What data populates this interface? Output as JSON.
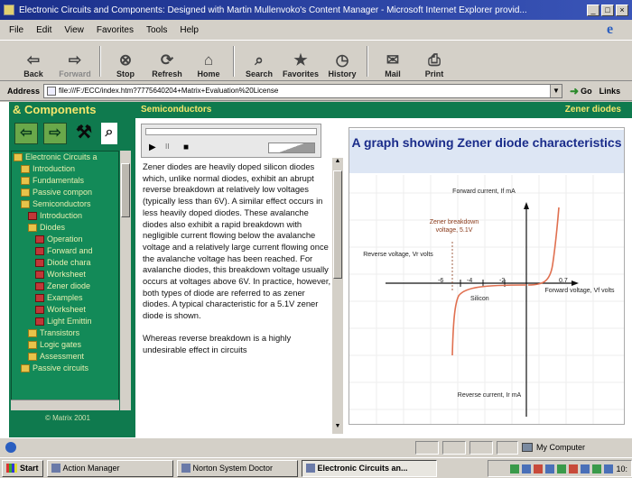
{
  "window": {
    "title": "Electronic Circuits and Components: Designed with Martin Mullenvoko's Content Manager - Microsoft Internet Explorer provid...",
    "controls": [
      "_",
      "□",
      "×"
    ]
  },
  "menu": [
    "File",
    "Edit",
    "View",
    "Favorites",
    "Tools",
    "Help"
  ],
  "toolbar": {
    "buttons": [
      {
        "label": "Back",
        "icon": "back-arrow-icon",
        "glyph": "⇦"
      },
      {
        "label": "Forward",
        "icon": "forward-arrow-icon",
        "glyph": "⇨"
      },
      {
        "label": "Stop",
        "icon": "stop-icon",
        "glyph": "⊗"
      },
      {
        "label": "Refresh",
        "icon": "refresh-icon",
        "glyph": "⟳"
      },
      {
        "label": "Home",
        "icon": "home-icon",
        "glyph": "⌂"
      },
      {
        "label": "Search",
        "icon": "search-icon",
        "glyph": "⌕"
      },
      {
        "label": "Favorites",
        "icon": "favorites-icon",
        "glyph": "★"
      },
      {
        "label": "History",
        "icon": "history-icon",
        "glyph": "◷"
      },
      {
        "label": "Mail",
        "icon": "mail-icon",
        "glyph": "✉"
      },
      {
        "label": "Print",
        "icon": "print-icon",
        "glyph": "⎙"
      }
    ]
  },
  "address": {
    "label": "Address",
    "url": "file:///F:/ECC/index.htm?7775640204+Matrix+Evaluation%20License",
    "go": "Go",
    "links": "Links"
  },
  "nav": {
    "header": "& Components",
    "tree": [
      {
        "label": "Electronic Circuits a",
        "type": "folder",
        "indent": 0
      },
      {
        "label": "Introduction",
        "type": "folder",
        "indent": 1
      },
      {
        "label": "Fundamentals",
        "type": "folder",
        "indent": 1
      },
      {
        "label": "Passive compon",
        "type": "folder",
        "indent": 1
      },
      {
        "label": "Semiconductors",
        "type": "folder",
        "indent": 1
      },
      {
        "label": "Introduction",
        "type": "diode",
        "indent": 2
      },
      {
        "label": "Diodes",
        "type": "folder",
        "indent": 2
      },
      {
        "label": "Operation",
        "type": "diode",
        "indent": 3
      },
      {
        "label": "Forward and",
        "type": "diode",
        "indent": 3
      },
      {
        "label": "Diode chara",
        "type": "diode",
        "indent": 3
      },
      {
        "label": "Worksheet",
        "type": "diode",
        "indent": 3
      },
      {
        "label": "Zener diode",
        "type": "diode",
        "indent": 3
      },
      {
        "label": "Examples",
        "type": "diode",
        "indent": 3
      },
      {
        "label": "Worksheet",
        "type": "diode",
        "indent": 3
      },
      {
        "label": "Light Emittin",
        "type": "diode",
        "indent": 3
      },
      {
        "label": "Transistors",
        "type": "folder",
        "indent": 2
      },
      {
        "label": "Logic gates",
        "type": "folder",
        "indent": 2
      },
      {
        "label": "Assessment",
        "type": "folder",
        "indent": 2
      },
      {
        "label": "Passive circuits",
        "type": "folder",
        "indent": 1
      }
    ],
    "copyright": "© Matrix 2001"
  },
  "section": {
    "left": "Semiconductors",
    "right": "Zener diodes"
  },
  "player": {
    "play": "▶",
    "pause": "II",
    "stop": "■"
  },
  "text": {
    "p1": "Zener diodes are heavily doped silicon diodes which, unlike normal diodes, exhibit an abrupt reverse breakdown at relatively low voltages (typically less than 6V). A similar effect occurs in less heavily doped diodes. These avalanche diodes also exhibit a rapid breakdown with negligible current flowing below the avalanche voltage and a relatively large current flowing once the avalanche voltage has been reached. For avalanche diodes, this breakdown voltage usually occurs at voltages above 6V. In practice, however, both types of diode are referred to as zener diodes. A typical characteristic for a 5.1V zener diode is shown.",
    "p2": "Whereas reverse breakdown is a highly undesirable effect in circuits"
  },
  "graph": {
    "title": "A graph showing Zener diode characteristics",
    "forward_current": "Forward current, If mA",
    "reverse_voltage": "Reverse voltage, Vr volts",
    "zener_breakdown": "Zener breakdown voltage, 5.1V",
    "forward_voltage": "Forward voltage, Vf volts",
    "reverse_current": "Reverse current, Ir mA",
    "silicon": "Silicon",
    "ticks": [
      "-6",
      "-4",
      "-2",
      "0.7"
    ],
    "curve_color": "#e07050"
  },
  "status": {
    "zone": "My Computer"
  },
  "taskbar": {
    "start": "Start",
    "tasks": [
      {
        "label": "Action Manager",
        "active": false
      },
      {
        "label": "Norton System Doctor",
        "active": false
      },
      {
        "label": "Electronic Circuits an...",
        "active": true
      }
    ],
    "clock": "10:"
  }
}
